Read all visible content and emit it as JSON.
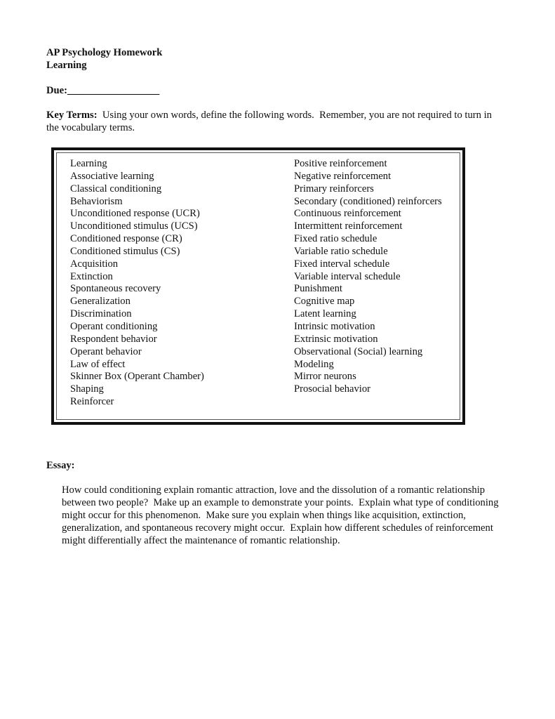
{
  "header": {
    "title": "AP Psychology Homework",
    "subtitle": "Learning",
    "due_label": "Due:",
    "due_blank": "__________________"
  },
  "key_terms": {
    "label": "Key Terms:",
    "instructions": "  Using your own words, define the following words.  Remember, you are not required to turn in the vocabulary terms.",
    "left_column": [
      "Learning",
      "Associative learning",
      "Classical conditioning",
      "Behaviorism",
      "Unconditioned response (UCR)",
      "Unconditioned stimulus (UCS)",
      "Conditioned response (CR)",
      "Conditioned stimulus (CS)",
      "Acquisition",
      "Extinction",
      "Spontaneous recovery",
      "Generalization",
      "Discrimination",
      "Operant conditioning",
      "Respondent behavior",
      "Operant behavior",
      "Law of effect",
      "Skinner Box (Operant Chamber)",
      "Shaping",
      "Reinforcer"
    ],
    "right_column": [
      "Positive reinforcement",
      "Negative reinforcement",
      "Primary reinforcers",
      "Secondary (conditioned) reinforcers",
      "Continuous reinforcement",
      "Intermittent reinforcement",
      "Fixed ratio schedule",
      "Variable ratio schedule",
      "Fixed interval schedule",
      "Variable interval schedule",
      "Punishment",
      "Cognitive map",
      "Latent learning",
      "Intrinsic motivation",
      "Extrinsic motivation",
      "Observational (Social) learning",
      "Modeling",
      "Mirror neurons",
      "Prosocial behavior"
    ]
  },
  "essay": {
    "label": "Essay:",
    "prompt": "How could conditioning explain romantic attraction, love and the dissolution of a romantic relationship between two people?  Make up an example to demonstrate your points.  Explain what type of conditioning might occur for this phenomenon.  Make sure you explain when things like acquisition, extinction, generalization, and spontaneous recovery might occur.  Explain how different schedules of reinforcement might differentially affect the maintenance of romantic relationship."
  }
}
